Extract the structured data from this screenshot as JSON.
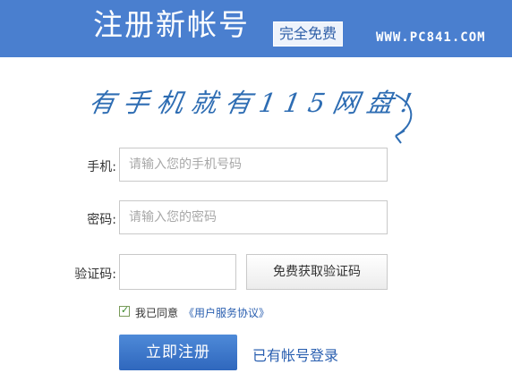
{
  "header": {
    "title": "注册新帐号",
    "badge": "完全免费",
    "site_url": "WWW.PC841.COM",
    "background_color": "#4a7fcf"
  },
  "slogan": "有手机就有115网盘!",
  "form": {
    "phone": {
      "label": "手机:",
      "placeholder": "请输入您的手机号码"
    },
    "password": {
      "label": "密码:",
      "placeholder": "请输入您的密码"
    },
    "captcha": {
      "label": "验证码:",
      "placeholder": "",
      "button_label": "免费获取验证码"
    },
    "agreement": {
      "checked": true,
      "text": "我已同意",
      "link_text": "《用户服务协议》"
    },
    "submit_label": "立即注册",
    "login_link": "已有帐号登录"
  },
  "colors": {
    "accent": "#2f67bd",
    "link": "#2a5fb0",
    "slogan": "#2e6db3"
  }
}
